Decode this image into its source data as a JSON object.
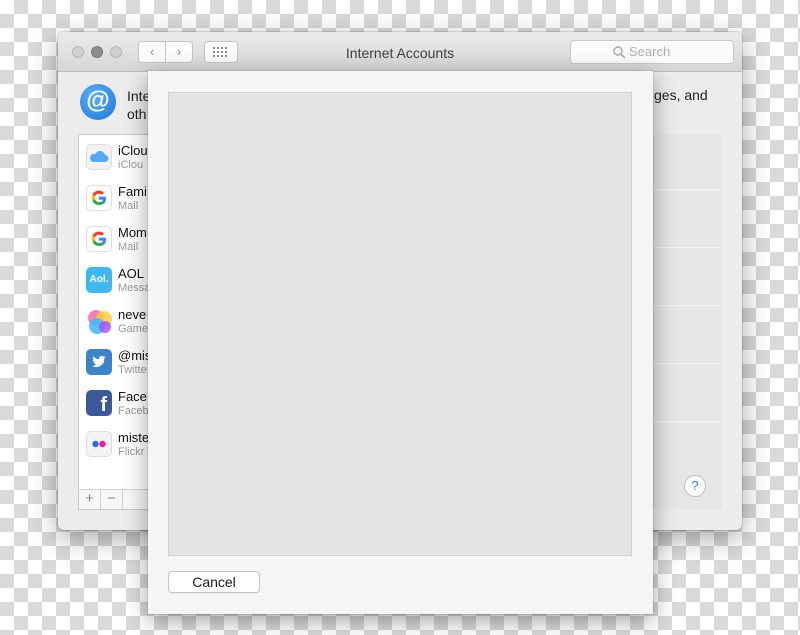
{
  "window": {
    "title": "Internet Accounts",
    "search_placeholder": "Search",
    "back_glyph": "‹",
    "forward_glyph": "›"
  },
  "header": {
    "icon_glyph": "@",
    "text_left_line1": "Inte",
    "text_left_line2": "oth",
    "text_right": "ges, and"
  },
  "accounts": [
    {
      "name": "iClou",
      "sub": "iClou",
      "icon": "icloud-icon",
      "color": "#5aa9f0"
    },
    {
      "name": "Fami",
      "sub": "Mail",
      "icon": "google-icon",
      "color": "#ffffff"
    },
    {
      "name": "Mom",
      "sub": "Mail",
      "icon": "google-icon",
      "color": "#ffffff"
    },
    {
      "name": "AOL",
      "sub": "Messa",
      "icon": "aol-icon",
      "icon_text": "Aol.",
      "color": "#3fb8f1"
    },
    {
      "name": "neve",
      "sub": "Game",
      "icon": "game-center-icon",
      "color": "#ff7aa8"
    },
    {
      "name": "@mis",
      "sub": "Twitte",
      "icon": "twitter-icon",
      "color": "#3d84c6"
    },
    {
      "name": "Face",
      "sub": "Faceb",
      "icon": "facebook-icon",
      "icon_text": "f",
      "color": "#3b5998"
    },
    {
      "name": "miste",
      "sub": "Flickr",
      "icon": "flickr-icon",
      "color": "#ffffff"
    }
  ],
  "sidebar_controls": {
    "add": "+",
    "remove": "−"
  },
  "help_label": "?",
  "sheet": {
    "cancel_label": "Cancel"
  }
}
